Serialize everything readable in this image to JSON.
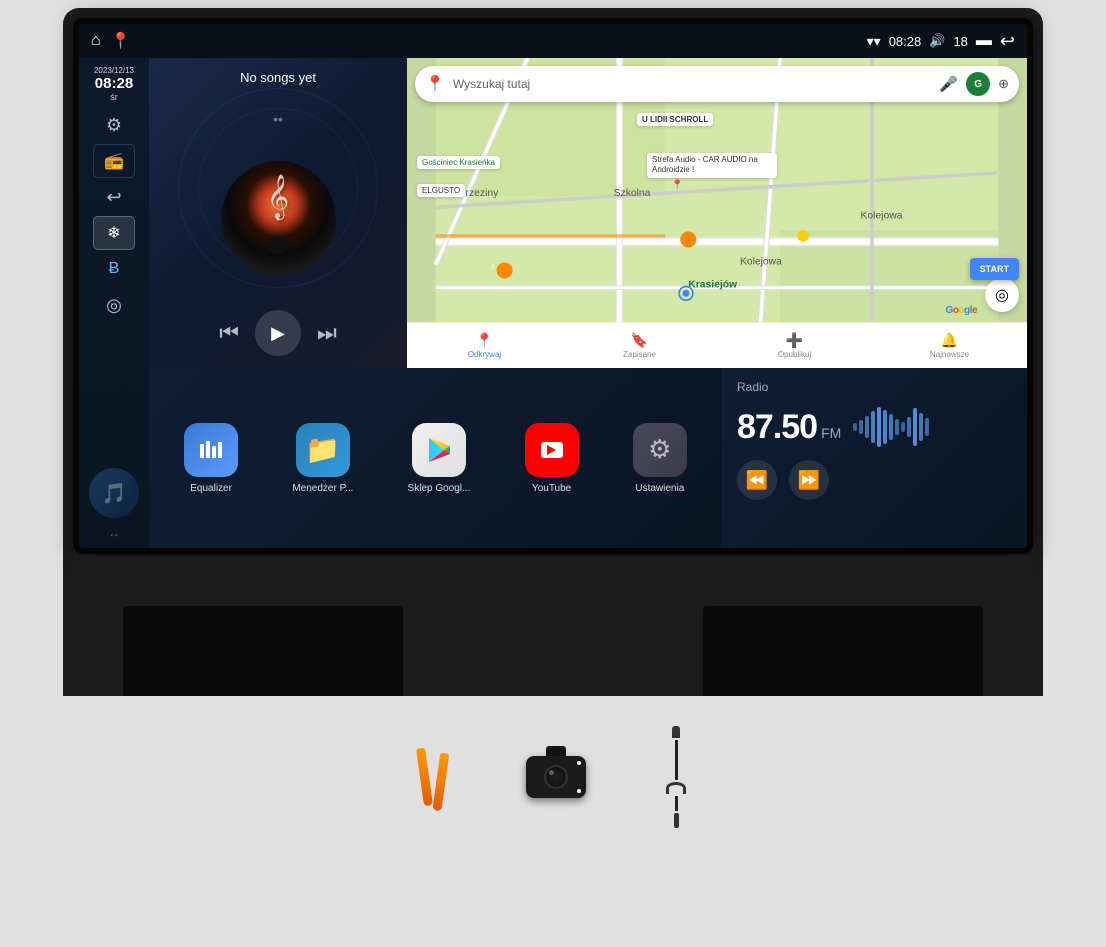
{
  "device": {
    "title": "Android Car Radio"
  },
  "statusBar": {
    "time": "08:28",
    "volume": "18",
    "wifiIcon": "▾",
    "batteryIcon": "▬",
    "backIcon": "↩",
    "homeIcon": "⌂",
    "mapsIcon": "📍"
  },
  "sidebar": {
    "date": "2023/12/13",
    "time": "08:28",
    "day": "śr",
    "buttons": [
      {
        "name": "settings-btn",
        "icon": "⚙",
        "label": "Settings"
      },
      {
        "name": "radio-btn",
        "icon": "📻",
        "label": "Radio"
      },
      {
        "name": "back-btn",
        "icon": "↩",
        "label": "Back"
      },
      {
        "name": "freeze-btn",
        "icon": "❄",
        "label": "Freeze"
      },
      {
        "name": "bluetooth-btn",
        "icon": "ʙ",
        "label": "Bluetooth"
      },
      {
        "name": "location-btn",
        "icon": "◎",
        "label": "Location"
      }
    ],
    "voiceBtn": {
      "icon": "🎵",
      "label": "Voice"
    }
  },
  "musicPlayer": {
    "title": "No songs yet",
    "dots": "••",
    "albumArtNote": "𝄞",
    "controls": {
      "prev": "⏮",
      "play": "▶",
      "next": "⏭"
    }
  },
  "maps": {
    "searchPlaceholder": "Wyszukaj tutaj",
    "searchIcon": "📍",
    "micIcon": "🎤",
    "accountInitial": "G",
    "layersIcon": "⊕",
    "labels": [
      "U LIDII SCHROLL",
      "Gościniec Krasieńka",
      "ELGUSTO",
      "Strefa Audio - CAR AUDIO na Androidzie !",
      "Brzeziny",
      "Szkolna",
      "Krasiejów",
      "Kolejowa",
      "Kolejowa"
    ],
    "bottomNav": [
      {
        "icon": "📍",
        "label": "Odkrywaj",
        "active": true
      },
      {
        "icon": "🔖",
        "label": "Zapisane",
        "active": false
      },
      {
        "icon": "🔄",
        "label": "Opublikuj",
        "active": false
      },
      {
        "icon": "🔔",
        "label": "Najnowsze",
        "active": false
      }
    ],
    "startBtn": "START",
    "googleLogo": "Google"
  },
  "apps": [
    {
      "name": "equalizer",
      "label": "Equalizer",
      "icon": "≡",
      "iconClass": "app-equalizer"
    },
    {
      "name": "file-manager",
      "label": "Menedżer P...",
      "icon": "📁",
      "iconClass": "app-files"
    },
    {
      "name": "google-play",
      "label": "Sklep Googl...",
      "icon": "▶",
      "iconClass": "app-playstore"
    },
    {
      "name": "youtube",
      "label": "YouTube",
      "icon": "▶",
      "iconClass": "app-youtube"
    },
    {
      "name": "settings",
      "label": "Ustawienia",
      "icon": "⚙",
      "iconClass": "app-settings"
    }
  ],
  "radio": {
    "label": "Radio",
    "frequency": "87.50",
    "band": "FM",
    "controls": {
      "rewind": "⏪",
      "forward": "⏩"
    },
    "waveBars": [
      8,
      14,
      22,
      30,
      38,
      32,
      24,
      16,
      10,
      20,
      35,
      28,
      18,
      12,
      8
    ]
  },
  "accessories": {
    "pryTool": "pry-tool",
    "camera": "backup-camera",
    "cable": "aux-cable"
  }
}
